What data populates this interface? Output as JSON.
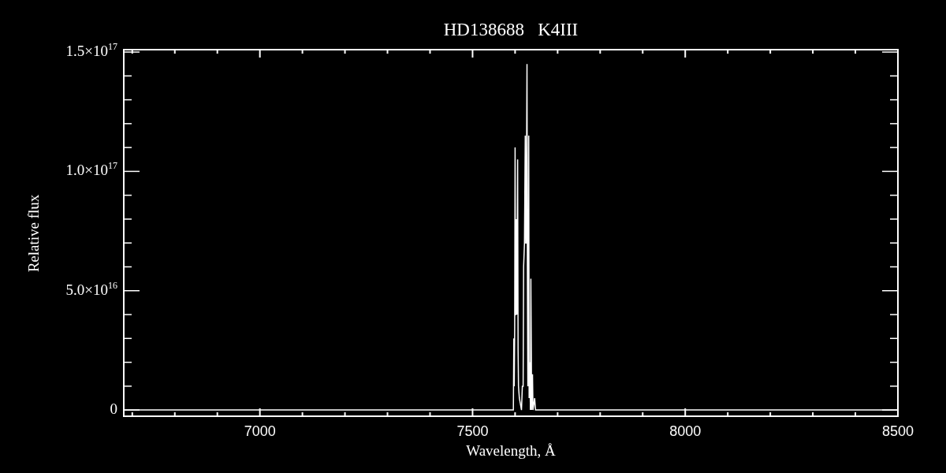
{
  "chart": {
    "chart_data": {
      "type": "line",
      "title": "HD138688   K4III",
      "xlabel": "Wavelength, Å",
      "ylabel": "Relative flux",
      "xlim": [
        6680,
        8500
      ],
      "ylim": [
        -2600000000000000.0,
        1.51e+17
      ],
      "xticks": [
        7000,
        7500,
        8000,
        8500
      ],
      "yticks": [
        {
          "value": 0,
          "label": "0"
        },
        {
          "value": 5e+16,
          "label": "5.0×10$^{16}$"
        },
        {
          "value": 1e+17,
          "label": "1.0×10$^{17}$"
        },
        {
          "value": 1.5e+17,
          "label": "1.5×10$^{17}$"
        }
      ],
      "x": [
        6680,
        7590,
        7596,
        7597,
        7598,
        7599,
        7600,
        7601,
        7602,
        7603,
        7604,
        7606,
        7607,
        7608,
        7610,
        7615,
        7617,
        7619,
        7620,
        7622,
        7624,
        7625,
        7626,
        7628,
        7629,
        7630,
        7632,
        7633,
        7635,
        7636,
        7637,
        7639,
        7641,
        7642,
        7646,
        7648,
        8500
      ],
      "series": [
        {
          "color": "#ffffff",
          "values": [
            0,
            0,
            0,
            3e+16,
            1e+16,
            3.5e+16,
            1.1e+17,
            4e+16,
            4e+16,
            8e+16,
            4e+16,
            1.05e+17,
            2.5e+16,
            1e+16,
            5000000000000000.0,
            0,
            1e+16,
            1e+16,
            6e+16,
            7e+16,
            1.15e+17,
            7e+16,
            7e+16,
            1.45e+17,
            6e+16,
            1e+16,
            1.15e+17,
            5000000000000000.0,
            2e+16,
            0,
            5.5e+16,
            0,
            1.5e+16,
            0,
            5000000000000000.0,
            0,
            0
          ]
        }
      ]
    }
  }
}
